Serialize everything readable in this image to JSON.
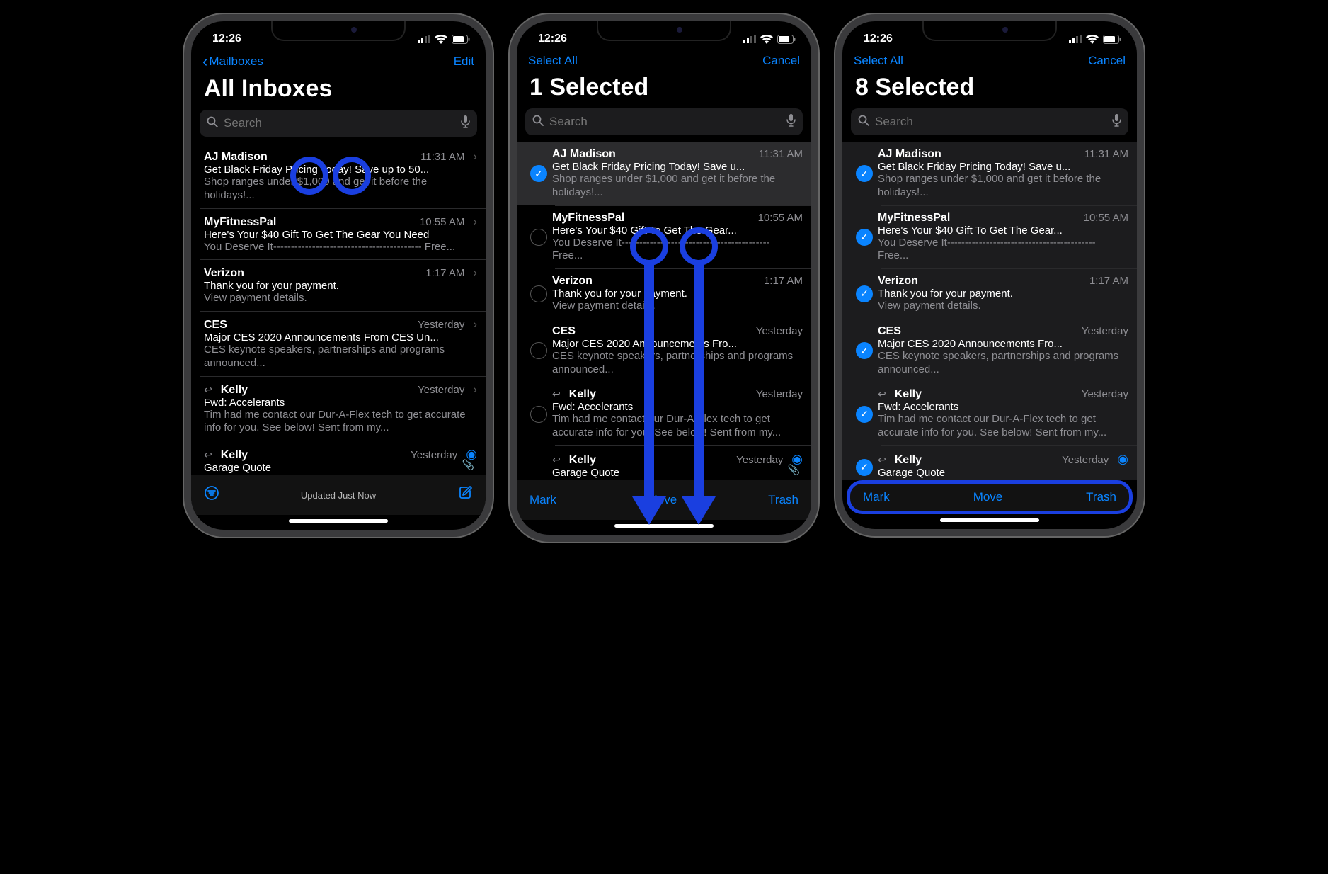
{
  "status": {
    "time": "12:26"
  },
  "search": {
    "placeholder": "Search"
  },
  "phones": [
    {
      "nav": {
        "left_icon": true,
        "left_label": "Mailboxes",
        "right_label": "Edit"
      },
      "title": "All Inboxes",
      "mode": "browse",
      "bottom": {
        "type": "status",
        "status_text": "Updated Just Now"
      }
    },
    {
      "nav": {
        "left_icon": false,
        "left_label": "Select All",
        "right_label": "Cancel"
      },
      "title": "1 Selected",
      "mode": "select",
      "selected_indices": [
        0
      ],
      "bottom": {
        "type": "actions",
        "mark": "Mark",
        "move": "Move",
        "trash": "Trash"
      }
    },
    {
      "nav": {
        "left_icon": false,
        "left_label": "Select All",
        "right_label": "Cancel"
      },
      "title": "8 Selected",
      "mode": "select",
      "selected_indices": [
        0,
        1,
        2,
        3,
        4,
        5
      ],
      "bottom": {
        "type": "actions",
        "mark": "Mark",
        "move": "Move",
        "trash": "Trash",
        "highlight": true
      }
    }
  ],
  "emails": [
    {
      "sender": "AJ Madison",
      "time": "11:31 AM",
      "subject": "Get Black Friday Pricing Today! Save up to 50...",
      "subject_sel": "Get Black Friday Pricing Today! Save u...",
      "preview": "Shop ranges under $1,000 and get it before the holidays!..."
    },
    {
      "sender": "MyFitnessPal",
      "time": "10:55 AM",
      "subject": "Here's Your $40 Gift To Get The Gear You Need",
      "subject_sel": "Here's Your $40 Gift To Get The Gear...",
      "preview": "You Deserve It------------------------------------------ Free..."
    },
    {
      "sender": "Verizon",
      "time": "1:17 AM",
      "subject": "Thank you for your payment.",
      "subject_sel": "Thank you for your payment.",
      "preview": "View payment details."
    },
    {
      "sender": "CES",
      "time": "Yesterday",
      "subject": "Major CES 2020 Announcements From CES Un...",
      "subject_sel": "Major CES 2020 Announcements Fro...",
      "preview": "CES keynote speakers, partnerships and programs announced..."
    },
    {
      "sender": "Kelly",
      "time": "Yesterday",
      "subject": "Fwd: Accelerants",
      "subject_sel": "Fwd: Accelerants",
      "preview": "Tim had me contact our Dur-A-Flex tech to get accurate info for you. See below! Sent from my...",
      "reply": true
    },
    {
      "sender": "Kelly",
      "time": "Yesterday",
      "subject": "Garage Quote",
      "subject_sel": "Garage Quote",
      "preview": "",
      "reply": true,
      "accessory": true,
      "attach": true
    }
  ]
}
